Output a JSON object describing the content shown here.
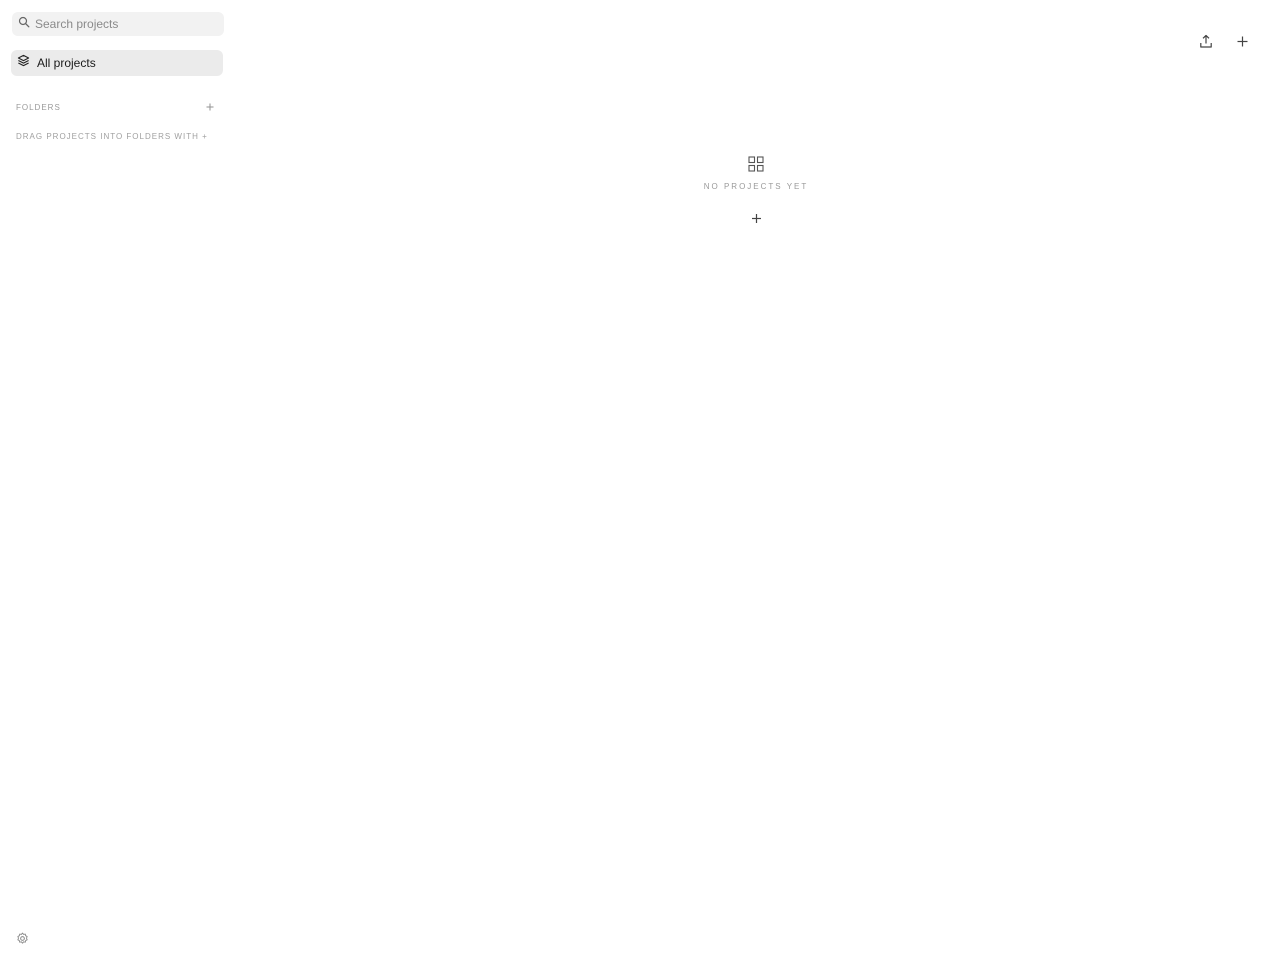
{
  "sidebar": {
    "search": {
      "placeholder": "Search projects",
      "icon": "search-icon"
    },
    "nav": {
      "all_projects_label": "All projects",
      "all_projects_icon": "layers-icon"
    },
    "folders": {
      "title": "FOLDERS",
      "add_icon": "plus-icon",
      "hint": "DRAG PROJECTS INTO FOLDERS WITH +"
    },
    "settings_icon": "gear-icon"
  },
  "toolbar": {
    "export_icon": "upload-icon",
    "new_icon": "plus-icon"
  },
  "empty_state": {
    "icon": "grid-icon",
    "text": "NO PROJECTS YET",
    "add_icon": "plus-icon"
  },
  "colors": {
    "background": "#ffffff",
    "sidebar_selected": "#ebebeb",
    "search_bg": "#f2f2f2",
    "muted_text": "#9a9a9a"
  }
}
